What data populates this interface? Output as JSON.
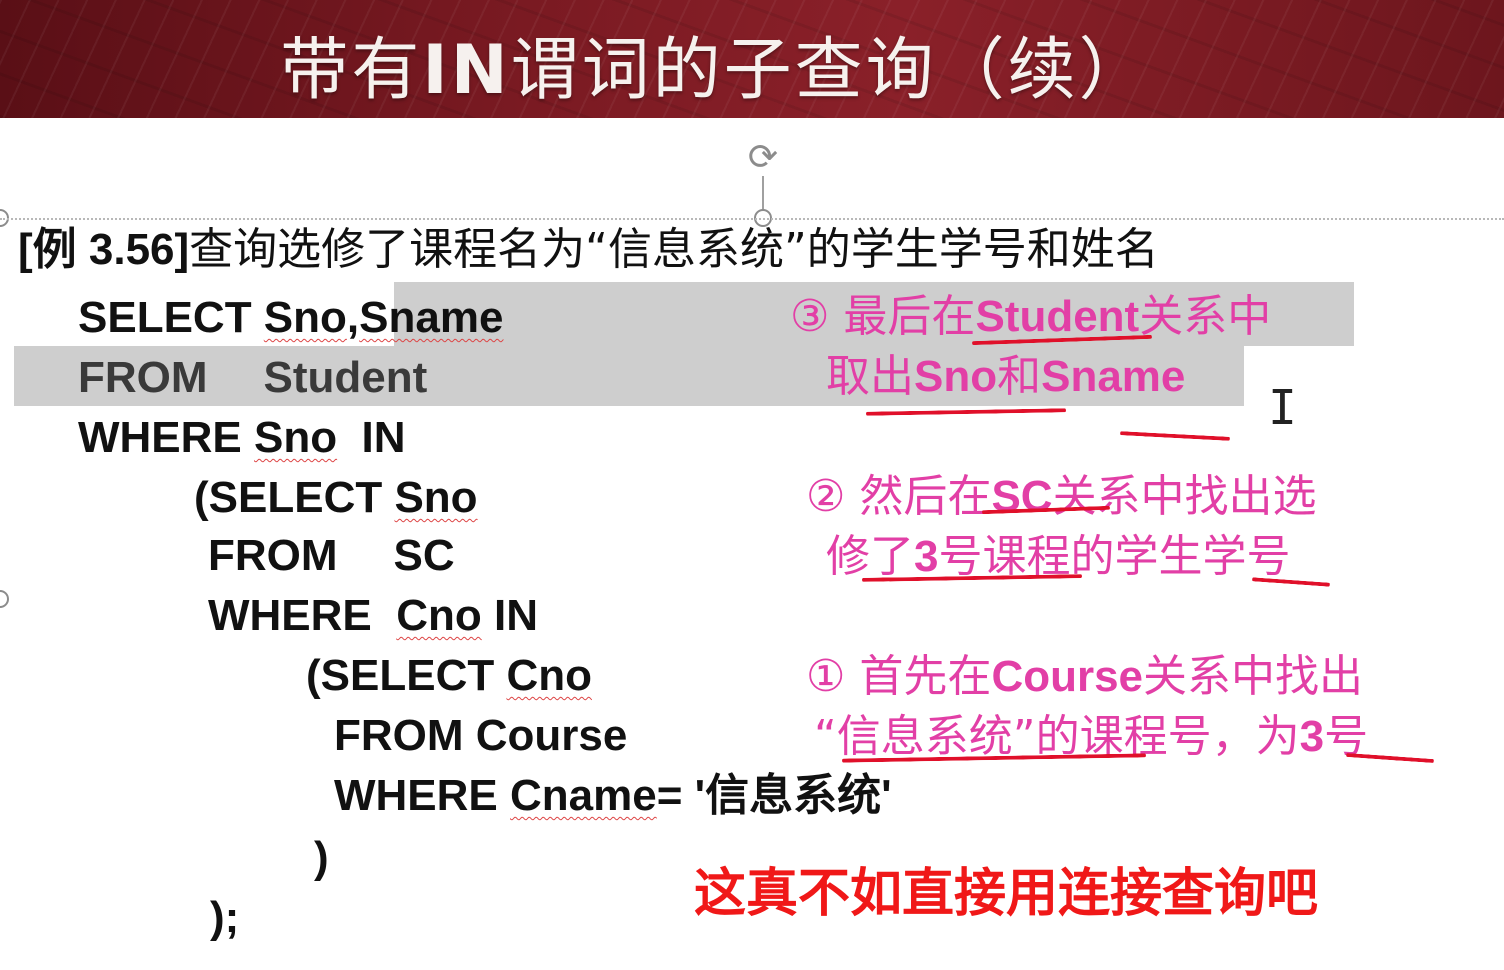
{
  "slide": {
    "title_part1": "带有",
    "title_bold": "IN",
    "title_part2": "谓词的子查询（续）"
  },
  "example": {
    "number": "[例 3.56]",
    "text": "查询选修了课程名为“信息系统”的学生学号和姓名"
  },
  "code": {
    "l1_kw": "SELECT ",
    "l1_a": "Sno",
    "l1_comma": ",",
    "l1_b": "Sname",
    "l2_kw": "FROM",
    "l2_tbl": "Student",
    "l3_kw": "WHERE ",
    "l3_a": "Sno",
    "l3_in": "  IN",
    "l4_kw": "(SELECT ",
    "l4_a": "Sno",
    "l5_kw": "FROM",
    "l5_tbl": "SC",
    "l6_kw": "WHERE  ",
    "l6_a": "Cno",
    "l6_in": " IN",
    "l7_kw": "(SELECT ",
    "l7_a": "Cno",
    "l8": "FROM Course",
    "l9_kw": "WHERE ",
    "l9_a": "Cname",
    "l9_rest": "= '信息系统'",
    "l10": ")",
    "l11": ");"
  },
  "notes": {
    "n3_line1_a": "③ 最后在",
    "n3_line1_b": "Student",
    "n3_line1_c": "关系中",
    "n3_line2_a": "取出",
    "n3_line2_b": "Sno",
    "n3_line2_c": "和",
    "n3_line2_d": "Sname",
    "n2_line1_a": "② 然后在",
    "n2_line1_b": "SC",
    "n2_line1_c": "关系中找出选",
    "n2_line2_a": "修了",
    "n2_line2_b": "3",
    "n2_line2_c": "号课程的学生学号",
    "n1_line1_a": "① 首先在",
    "n1_line1_b": "Course",
    "n1_line1_c": "关系中找出",
    "n1_line2_a": "“信息系统”的课程号，为",
    "n1_line2_b": "3",
    "n1_line2_c": "号"
  },
  "comment": "这真不如直接用连接查询吧",
  "colors": {
    "banner": "#7a1a22",
    "note_pink": "#e23fa6",
    "annotation_red": "#e0102a",
    "highlight": "#bdbdbd"
  },
  "icons": {
    "rotate": "rotate-handle-icon",
    "cursor": "text-cursor-icon"
  }
}
